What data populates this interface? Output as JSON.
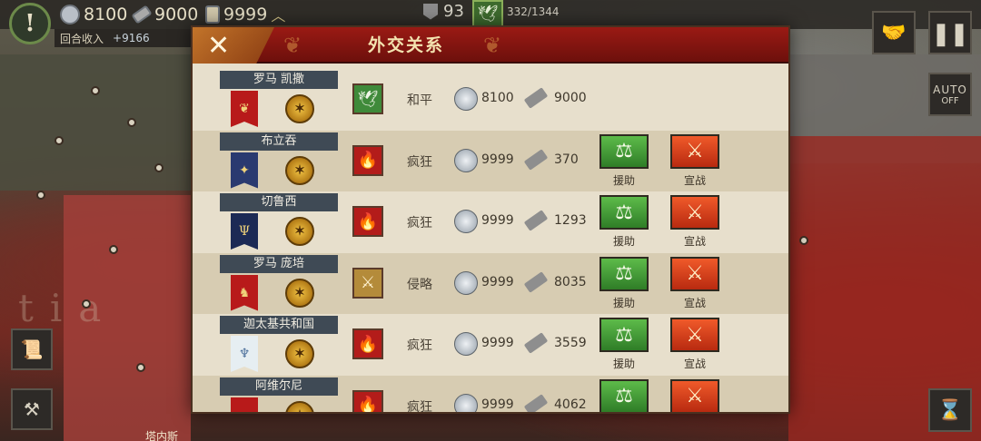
{
  "top": {
    "alert_icon": "exclamation-icon",
    "gold_value": "8100",
    "industry_value": "9000",
    "science_value": "9999",
    "turn_income_label": "回合收入",
    "turn_income_value": "+9166",
    "mid_value": "93",
    "population": "332/1344"
  },
  "map": {
    "bottom_label": "塔内斯",
    "watermark": "tia"
  },
  "dialog": {
    "title": "外交关系",
    "rows": [
      {
        "name": "罗马 凯撒",
        "stance": "和平",
        "stance_icon": "dove-icon",
        "gold": "8100",
        "industry": "9000",
        "aid_label": "",
        "war_label": ""
      },
      {
        "name": "布立吞",
        "stance": "疯狂",
        "stance_icon": "flame-icon",
        "gold": "9999",
        "industry": "370",
        "aid_label": "援助",
        "war_label": "宣战"
      },
      {
        "name": "切鲁西",
        "stance": "疯狂",
        "stance_icon": "flame-icon",
        "gold": "9999",
        "industry": "1293",
        "aid_label": "援助",
        "war_label": "宣战"
      },
      {
        "name": "罗马 庞培",
        "stance": "侵略",
        "stance_icon": "crossed-swords-icon",
        "gold": "9999",
        "industry": "8035",
        "aid_label": "援助",
        "war_label": "宣战"
      },
      {
        "name": "迦太基共和国",
        "stance": "疯狂",
        "stance_icon": "flame-icon",
        "gold": "9999",
        "industry": "3559",
        "aid_label": "援助",
        "war_label": "宣战"
      },
      {
        "name": "阿维尔尼",
        "stance": "疯狂",
        "stance_icon": "flame-icon",
        "gold": "9999",
        "industry": "4062",
        "aid_label": "",
        "war_label": ""
      }
    ]
  },
  "side": {
    "auto_label": "AUTO",
    "auto_state": "OFF"
  },
  "colors": {
    "header_red": "#9a1a14",
    "aid_green": "#2f7d27",
    "war_red": "#b82a10"
  }
}
